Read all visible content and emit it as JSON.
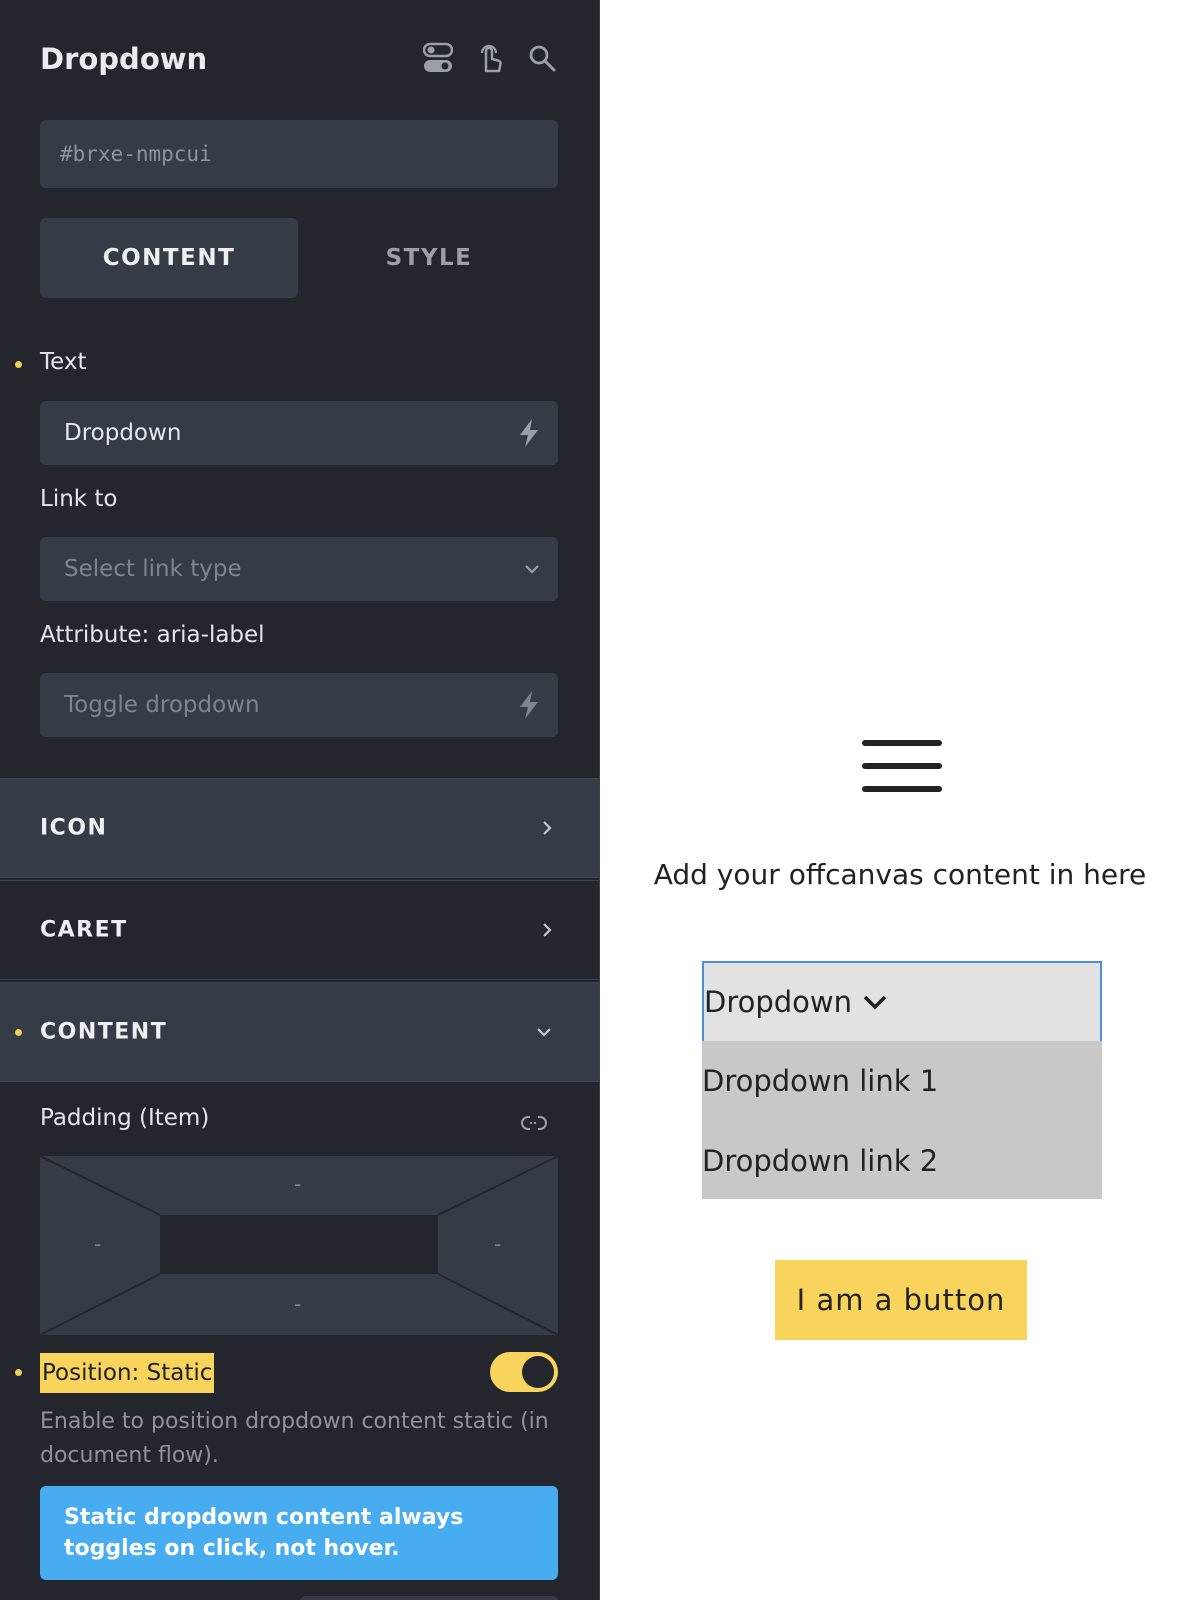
{
  "panel": {
    "title": "Dropdown",
    "element_id": "#brxe-nmpcui",
    "tabs": [
      {
        "label": "CONTENT"
      },
      {
        "label": "STYLE"
      }
    ],
    "text_field": {
      "label": "Text",
      "value": "Dropdown"
    },
    "link_to": {
      "label": "Link to",
      "placeholder": "Select link type"
    },
    "aria_label": {
      "label": "Attribute: aria-label",
      "placeholder": "Toggle dropdown"
    },
    "sections": [
      {
        "title": "ICON"
      },
      {
        "title": "CARET"
      },
      {
        "title": "CONTENT"
      }
    ],
    "padding": {
      "label": "Padding (Item)",
      "top": "-",
      "right": "-",
      "bottom": "-",
      "left": "-"
    },
    "position_static": {
      "label": "Position: Static",
      "enabled": true,
      "description": "Enable to position dropdown content static (in document flow).",
      "note": "Static dropdown content always toggles on click, not hover."
    },
    "icons": [
      "toggle-icon",
      "pointer-icon",
      "search-icon",
      "bolt-icon",
      "chevron-down-icon",
      "chevron-right-icon",
      "unlink-icon"
    ],
    "colors": {
      "panel_bg": "#23262c",
      "field_bg": "#363c46",
      "accent": "#f9d45d",
      "info": "#48adf0"
    }
  },
  "canvas": {
    "offcanvas_text": "Add your offcanvas content in here",
    "dropdown": {
      "label": "Dropdown",
      "links": [
        "Dropdown link 1",
        "Dropdown link 2"
      ]
    },
    "button_label": "I am a button"
  }
}
